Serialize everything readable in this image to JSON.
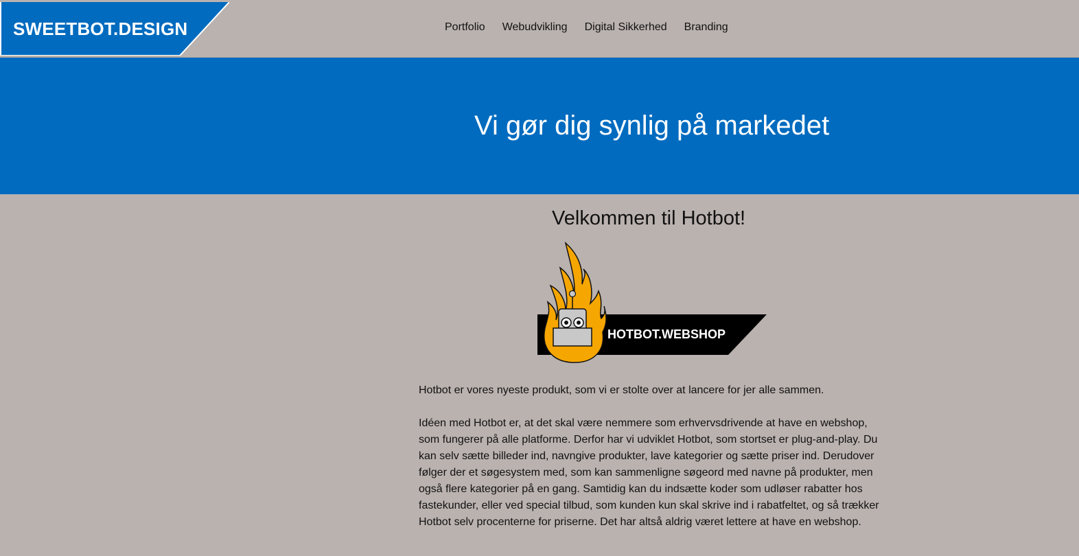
{
  "header": {
    "logo_text": "SWEETBOT.DESIGN",
    "nav": [
      {
        "label": "Portfolio"
      },
      {
        "label": "Webudvikling"
      },
      {
        "label": "Digital Sikkerhed"
      },
      {
        "label": "Branding"
      }
    ]
  },
  "hero": {
    "title": "Vi gør dig synlig på markedet"
  },
  "main": {
    "heading": "Velkommen til Hotbot!",
    "product_logo": {
      "text": "HOTBOT.WEBSHOP",
      "icon": "flaming-robot-icon"
    },
    "paragraphs": [
      "Hotbot er vores nyeste produkt, som vi er stolte over at lancere for jer alle sammen.",
      "Idéen med Hotbot er, at det skal være nemmere som erhvervsdrivende at have en webshop, som fungerer på alle platforme. Derfor har vi udviklet Hotbot, som stortset er plug-and-play. Du kan selv sætte billeder ind, navngive produkter, lave kategorier og sætte priser ind. Derudover følger der et søgesystem med, som kan sammenligne søgeord med navne på produkter, men også flere kategorier på en gang. Samtidig kan du indsætte koder som udløser rabatter hos fastekunder, eller ved special tilbud, som kunden kun skal skrive ind i rabatfeltet, og så trækker Hotbot selv procenterne for priserne. Det har altså aldrig været lettere at have en webshop."
    ]
  },
  "colors": {
    "brand_blue": "#006bbf",
    "background": "#bab2af",
    "flame_orange": "#f6a600",
    "robot_grey": "#c8c8c8"
  }
}
